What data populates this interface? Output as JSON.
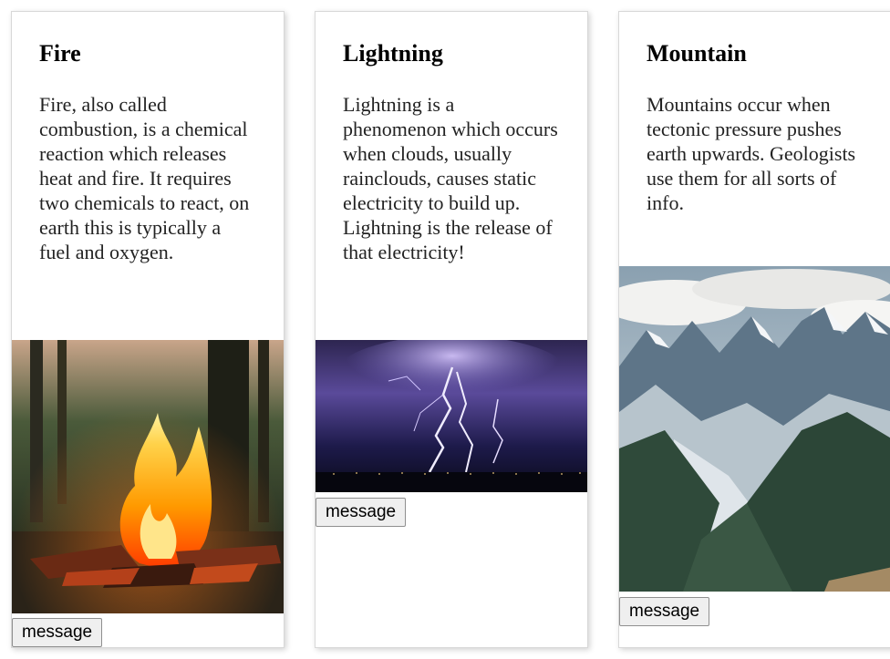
{
  "cards": [
    {
      "title": "Fire",
      "text": "Fire, also called combustion, is a chemical reaction which releases heat and fire. It requires two chemicals to react, on earth this is typically a fuel and oxygen.",
      "image_subject": "campfire",
      "button_label": "message"
    },
    {
      "title": "Lightning",
      "text": "Lightning is a phenomenon which occurs when clouds, usually rainclouds, causes static electricity to build up. Lightning is the release of that electricity!",
      "image_subject": "lightning-storm",
      "button_label": "message"
    },
    {
      "title": "Mountain",
      "text": "Mountains occur when tectonic pressure pushes earth upwards. Geologists use them for all sorts of info.",
      "image_subject": "mountain-range",
      "button_label": "message"
    }
  ]
}
